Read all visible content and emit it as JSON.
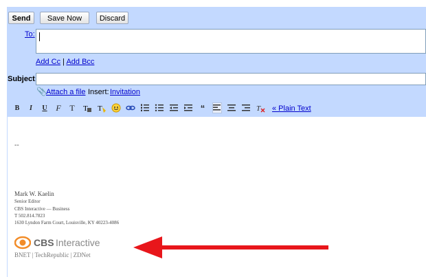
{
  "buttons": {
    "send": "Send",
    "save_now": "Save Now",
    "discard": "Discard"
  },
  "fields": {
    "to_label": "To:",
    "add_cc": "Add Cc",
    "separator": "|",
    "add_bcc": "Add Bcc",
    "subject_label": "Subject:",
    "attach": "Attach a file",
    "insert_label": "Insert:",
    "invitation": "Invitation"
  },
  "toolbar": {
    "bold": "B",
    "italic": "I",
    "underline": "U",
    "font": "F",
    "size": "T",
    "plain_text": "« Plain Text"
  },
  "body": {
    "dashes": "--",
    "sig_name": "Mark W. Kaelin",
    "sig_title": "Senior Editor",
    "sig_company": "CBS Interactive — Business",
    "sig_phone": "T 502.814.7823",
    "sig_address": "1630 Lyndon Farm Court, Louisville, KY 40223-4086",
    "logo_cbs": "CBS",
    "logo_interactive": "Interactive",
    "brands": "BNET | TechRepublic | ZDNet"
  },
  "colors": {
    "panel": "#c3d9ff",
    "arrow": "#e8161b"
  }
}
